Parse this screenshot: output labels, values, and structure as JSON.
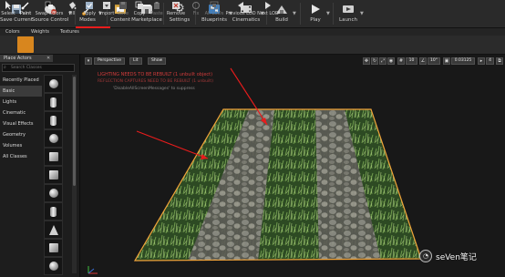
{
  "toolbar": {
    "items": [
      {
        "label": "Save Current",
        "icon": "floppy-icon"
      },
      {
        "label": "Source Control",
        "icon": "source-control-icon"
      },
      {
        "label": "Modes",
        "icon": "brush-icon"
      },
      {
        "label": "Content",
        "icon": "content-icon"
      },
      {
        "label": "Marketplace",
        "icon": "marketplace-icon"
      },
      {
        "label": "Settings",
        "icon": "gear-icon"
      },
      {
        "label": "Blueprints",
        "icon": "blueprint-icon"
      },
      {
        "label": "Cinematics",
        "icon": "film-icon"
      },
      {
        "label": "Build",
        "icon": "build-icon"
      },
      {
        "label": "Play",
        "icon": "play-icon"
      },
      {
        "label": "Launch",
        "icon": "launch-icon"
      }
    ],
    "annotation_color": "#e81c1c"
  },
  "mode_tabs": [
    "Colors",
    "Weights",
    "Textures"
  ],
  "paint_tools": [
    {
      "label": "Select",
      "icon": "cursor-icon"
    },
    {
      "label": "Paint",
      "icon": "paintbrush-icon",
      "active": true
    },
    {
      "label": "Swap Colors",
      "icon": "swap-icon"
    },
    {
      "label": "Fill",
      "icon": "bucket-icon"
    },
    {
      "label": "Apply",
      "icon": "check-icon"
    },
    {
      "label": "Import",
      "icon": "import-icon"
    },
    {
      "label": "Save",
      "icon": "save-icon",
      "disabled": true
    },
    {
      "label": "Copy",
      "icon": "copy-icon"
    },
    {
      "label": "Paste",
      "icon": "paste-icon",
      "disabled": true
    },
    {
      "label": "Remove",
      "icon": "remove-icon"
    },
    {
      "label": "Fix",
      "icon": "fix-icon",
      "disabled": true
    },
    {
      "label": "All LODs",
      "icon": "lods-icon",
      "disabled": true
    },
    {
      "label": "Previous LOD",
      "icon": "prev-icon"
    },
    {
      "label": "Next LOD",
      "icon": "next-icon"
    }
  ],
  "panel": {
    "tab_title": "Place Actors",
    "search_placeholder": "Search Classes",
    "categories": [
      {
        "label": "Recently Placed"
      },
      {
        "label": "Basic",
        "active": true
      },
      {
        "label": "Lights"
      },
      {
        "label": "Cinematic"
      },
      {
        "label": "Visual Effects"
      },
      {
        "label": "Geometry"
      },
      {
        "label": "Volumes"
      },
      {
        "label": "All Classes"
      }
    ]
  },
  "viewport": {
    "perspective_label": "Perspective",
    "lit_label": "Lit",
    "show_label": "Show",
    "grid_value": "10",
    "angle_value": "10°",
    "scale_value": "0.03125",
    "camera_speed": "4",
    "warnings": {
      "lighting": "LIGHTING NEEDS TO BE REBUILT (1 unbuilt object)",
      "reflection": "REFLECTION CAPTURES NEED TO BE REBUILT (1 unbuilt)",
      "suppress": "'DisableAllScreenMessages' to suppress"
    },
    "warning_color": "#d23b3b",
    "selection_color": "#f2a43a"
  },
  "watermark": {
    "text": "seVen笔记",
    "icon": "wechat-icon"
  }
}
